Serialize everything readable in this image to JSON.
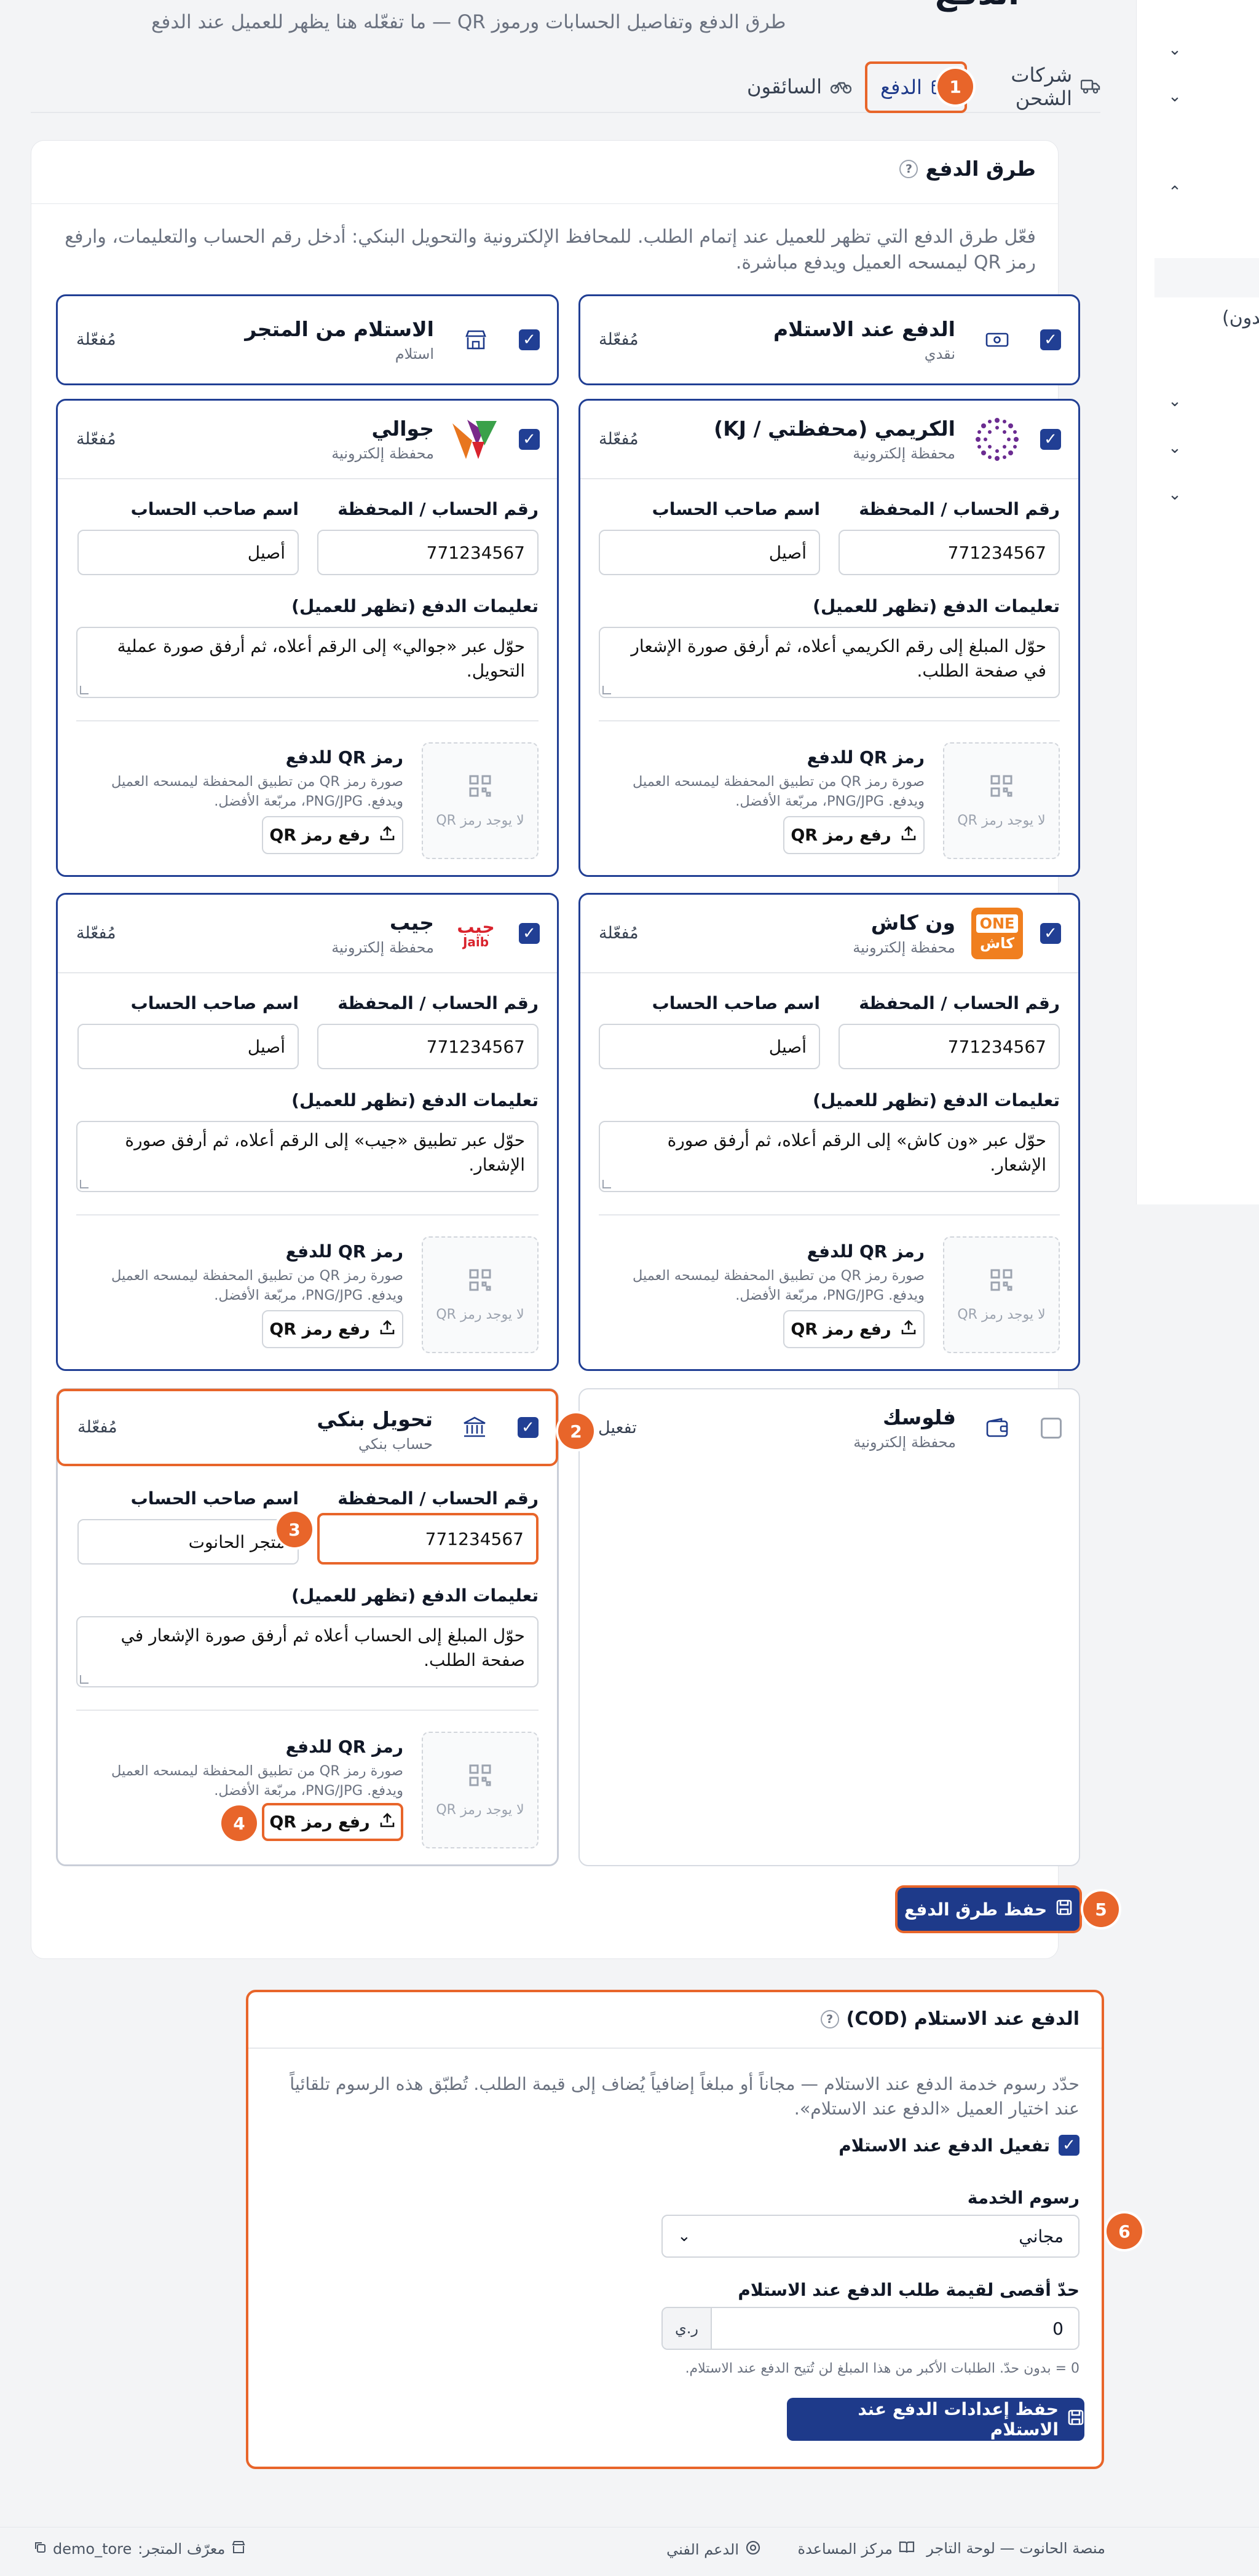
{
  "header": {
    "title": "الدفع",
    "subtitle": "طرق الدفع وتفاصيل الحسابات ورموز QR — ما تفعّله هنا يظهر للعميل عند الدفع"
  },
  "tabs": [
    {
      "label": "شركات الشحن"
    },
    {
      "label": "الدفع"
    },
    {
      "label": "السائقون"
    }
  ],
  "steps": [
    "1",
    "2",
    "3",
    "4",
    "5",
    "6"
  ],
  "payment_methods_card": {
    "title": "طرق الدفع",
    "description": "فعّل طرق الدفع التي تظهر للعميل عند إتمام الطلب. للمحافظ الإلكترونية والتحويل البنكي: أدخل رقم الحساب والتعليمات، وارفع رمز QR ليمسحه العميل ويدفع مباشرة."
  },
  "labels": {
    "account_number": "رقم الحساب / المحفظة",
    "account_holder": "اسم صاحب الحساب",
    "instructions": "تعليمات الدفع (تظهر للعميل)",
    "qr_title": "رمز QR للدفع",
    "qr_help": "صورة رمز QR من تطبيق المحفظة ليمسحه العميل ويدفع. PNG/JPG، مربّعة الأفضل.",
    "no_qr": "لا يوجد رمز QR",
    "upload_qr": "رفع رمز QR",
    "status_enabled": "مُفعّلة",
    "status_activate": "تفعيل"
  },
  "methods": {
    "cod": {
      "name": "الدفع عند الاستلام",
      "type": "نقدي"
    },
    "pickup": {
      "name": "الاستلام من المتجر",
      "type": "استلام"
    },
    "kuraimi": {
      "name": "الكريمي (محفظتي / KJ)",
      "type": "محفظة إلكترونية",
      "account": "771234567",
      "holder": "أصيل",
      "instructions": "حوّل المبلغ إلى رقم الكريمي أعلاه، ثم أرفق صورة الإشعار في صفحة الطلب."
    },
    "jawali": {
      "name": "جوالي",
      "type": "محفظة إلكترونية",
      "account": "771234567",
      "holder": "أصيل",
      "instructions": "حوّل عبر «جوالي» إلى الرقم أعلاه، ثم أرفق صورة عملية التحويل."
    },
    "onecash": {
      "name": "ون كاش",
      "type": "محفظة إلكترونية",
      "account": "771234567",
      "holder": "أصيل",
      "instructions": "حوّل عبر «ون كاش» إلى الرقم أعلاه، ثم أرفق صورة الإشعار.",
      "logo_top": "ONE",
      "logo_bottom": "كاش"
    },
    "jaib": {
      "name": "جيب",
      "type": "محفظة إلكترونية",
      "account": "771234567",
      "holder": "أصيل",
      "instructions": "حوّل عبر تطبيق «جيب» إلى الرقم أعلاه، ثم أرفق صورة الإشعار.",
      "logo_ar": "جيب",
      "logo_en": "Jaib"
    },
    "floosak": {
      "name": "فلوسك",
      "type": "محفظة إلكترونية"
    },
    "bank": {
      "name": "تحويل بنكي",
      "type": "حساب بنكي",
      "account": "771234567",
      "holder": "متجر الحانوت",
      "instructions": "حوّل المبلغ إلى الحساب أعلاه ثم أرفق صورة الإشعار في صفحة الطلب."
    }
  },
  "save_payments_label": "حفظ طرق الدفع",
  "cod_settings": {
    "title": "الدفع عند الاستلام (COD)",
    "description": "حدّد رسوم خدمة الدفع عند الاستلام — مجاناً أو مبلغاً إضافياً يُضاف إلى قيمة الطلب. تُطبّق هذه الرسوم تلقائياً عند اختيار العميل «الدفع عند الاستلام».",
    "enable_label": "تفعيل الدفع عند الاستلام",
    "fee_label": "رسوم الخدمة",
    "fee_value": "مجاني",
    "max_label": "حدّ أقصى لقيمة طلب الدفع عند الاستلام",
    "max_value": "0",
    "currency": "ر.ي",
    "max_hint": "0 = بدون حدّ. الطلبات الأكبر من هذا المبلغ لن تُتيح الدفع عند الاستلام.",
    "save_label": "حفظ إعدادات الدفع عند الاستلام"
  },
  "footer": {
    "platform": "منصة الحانوت — لوحة التاجر",
    "help_center": "مركز المساعدة",
    "support": "الدعم الفني",
    "store_id_label": "معرّف المتجر:",
    "store_id": "demo_tore"
  },
  "sidebar_partial_text": "(بدون",
  "colors": {
    "accent": "#1e3a8a",
    "highlight": "#e8652a"
  },
  "icons": [
    "truck-icon",
    "card-icon",
    "bicycle-icon",
    "help-icon",
    "cash-icon",
    "store-icon",
    "qr-icon",
    "upload-icon",
    "save-icon",
    "wallet-icon",
    "bank-icon",
    "book-icon",
    "support-icon",
    "copy-icon",
    "chevron-down-icon",
    "chevron-up-icon"
  ]
}
